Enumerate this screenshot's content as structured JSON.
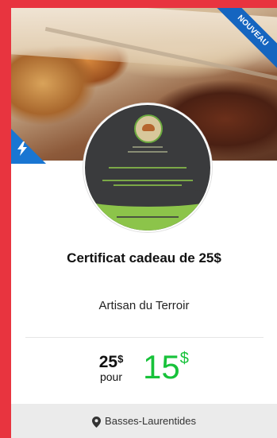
{
  "badge": {
    "label": "NOUVEAU"
  },
  "offer": {
    "title": "Certificat cadeau de 25$",
    "vendor": "Artisan du Terroir"
  },
  "pricing": {
    "original_value": "25",
    "original_currency": "$",
    "for_label": "pour",
    "sale_value": "15",
    "sale_currency": "$"
  },
  "location": {
    "region": "Basses-Laurentides"
  },
  "icons": {
    "flash": "lightning-icon",
    "location": "map-pin-icon"
  },
  "colors": {
    "page_background": "#e8343f",
    "ribbon": "#1565c0",
    "sale_price": "#17c23a",
    "logo_background": "#3a3b3d",
    "logo_accent": "#8cc44a"
  }
}
